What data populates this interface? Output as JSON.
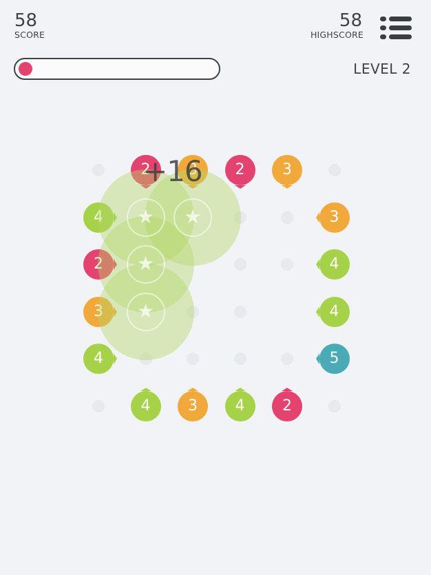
{
  "header": {
    "score_value": "58",
    "score_label": "SCORE",
    "highscore_value": "58",
    "highscore_label": "HIGHSCORE",
    "level_text": "LEVEL 2",
    "menu_icon": "hamburger-list-icon"
  },
  "progress": {
    "fraction": 0.04,
    "color": "#e5436f"
  },
  "colors": {
    "2": "#e5436f",
    "3": "#f2a93b",
    "4": "#a6d24a",
    "5": "#4aabb6"
  },
  "floating_points": "+16",
  "board": {
    "rows": 6,
    "cols": 6,
    "empty_dots": [
      [
        0,
        0
      ],
      [
        0,
        5
      ],
      [
        1,
        3
      ],
      [
        1,
        4
      ],
      [
        2,
        3
      ],
      [
        2,
        4
      ],
      [
        3,
        2
      ],
      [
        3,
        3
      ],
      [
        4,
        1
      ],
      [
        4,
        2
      ],
      [
        4,
        3
      ],
      [
        4,
        4
      ],
      [
        5,
        0
      ],
      [
        5,
        5
      ]
    ],
    "cleared_star_cells": [
      [
        1,
        1
      ],
      [
        1,
        2
      ],
      [
        2,
        1
      ],
      [
        3,
        1
      ]
    ],
    "tiles": [
      {
        "r": 0,
        "c": 1,
        "value": "2",
        "pointer": "down"
      },
      {
        "r": 0,
        "c": 2,
        "value": "3",
        "pointer": "down"
      },
      {
        "r": 0,
        "c": 3,
        "value": "2",
        "pointer": "down"
      },
      {
        "r": 0,
        "c": 4,
        "value": "3",
        "pointer": "down"
      },
      {
        "r": 1,
        "c": 0,
        "value": "4",
        "pointer": "right"
      },
      {
        "r": 1,
        "c": 5,
        "value": "3",
        "pointer": "left"
      },
      {
        "r": 2,
        "c": 0,
        "value": "2",
        "pointer": "right"
      },
      {
        "r": 2,
        "c": 5,
        "value": "4",
        "pointer": "left"
      },
      {
        "r": 3,
        "c": 0,
        "value": "3",
        "pointer": "right"
      },
      {
        "r": 3,
        "c": 5,
        "value": "4",
        "pointer": "left"
      },
      {
        "r": 4,
        "c": 0,
        "value": "4",
        "pointer": "right"
      },
      {
        "r": 4,
        "c": 5,
        "value": "5",
        "pointer": "left"
      },
      {
        "r": 5,
        "c": 1,
        "value": "4",
        "pointer": "up"
      },
      {
        "r": 5,
        "c": 2,
        "value": "3",
        "pointer": "up"
      },
      {
        "r": 5,
        "c": 3,
        "value": "4",
        "pointer": "up"
      },
      {
        "r": 5,
        "c": 4,
        "value": "2",
        "pointer": "up"
      }
    ]
  }
}
